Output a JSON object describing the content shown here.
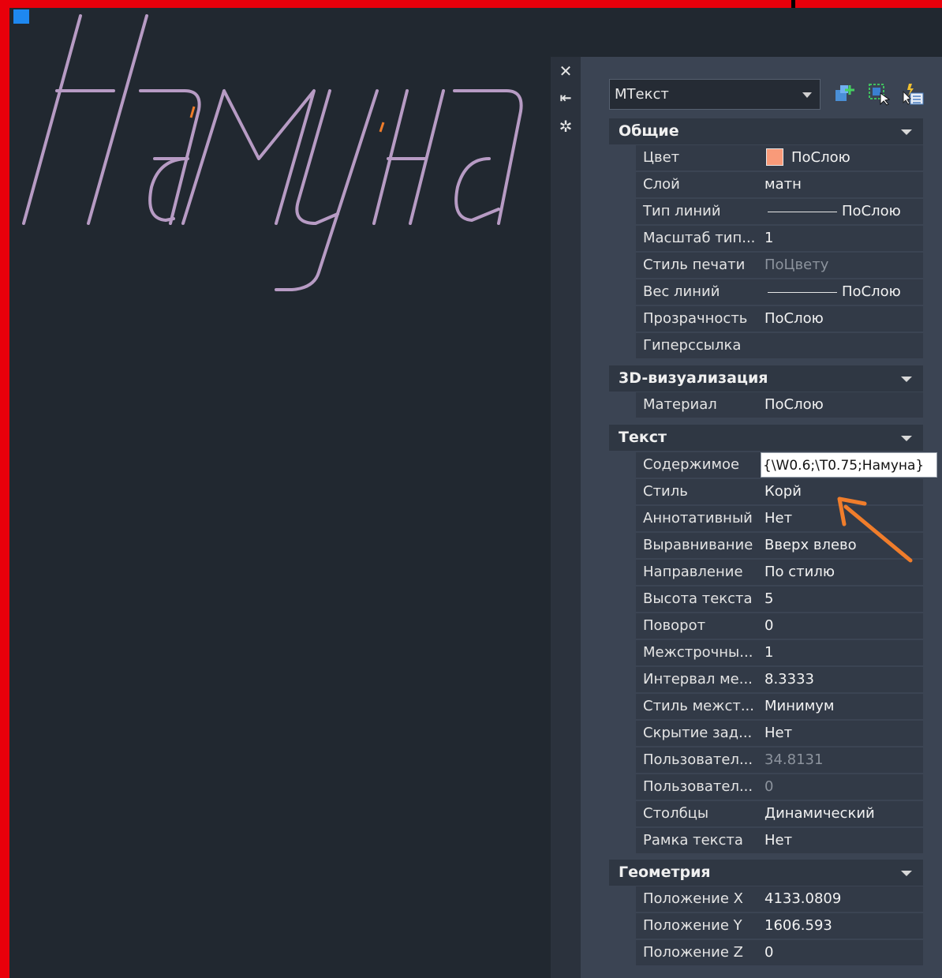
{
  "drawing": {
    "text": "Намуна"
  },
  "strip": {
    "close_glyph": "✕",
    "pin_glyph": "⇤",
    "settings_glyph": "✲"
  },
  "selector": {
    "value": "МТекст"
  },
  "sections": {
    "general": "Общие",
    "viz3d": "3D-визуализация",
    "text": "Текст",
    "geometry": "Геометрия"
  },
  "general": [
    {
      "key": "Цвет",
      "value": "ПоСлою",
      "swatch": "#f99a79"
    },
    {
      "key": "Слой",
      "value": "матн"
    },
    {
      "key": "Тип линий",
      "value": "ПоСлою"
    },
    {
      "key": "Масштаб тип...",
      "value": "1"
    },
    {
      "key": "Стиль печати",
      "value": "ПоЦвету"
    },
    {
      "key": "Вес линий",
      "value": "ПоСлою"
    },
    {
      "key": "Прозрачность",
      "value": "ПоСлою"
    },
    {
      "key": "Гиперссылка",
      "value": ""
    }
  ],
  "viz3d": [
    {
      "key": "Материал",
      "value": "ПоСлою"
    }
  ],
  "text": [
    {
      "key": "Содержимое",
      "value": "{\\W0.6;\\T0.75;Намуна}"
    },
    {
      "key": "Стиль",
      "value": "Корй"
    },
    {
      "key": "Аннотативный",
      "value": "Нет"
    },
    {
      "key": "Выравнивание",
      "value": "Вверх влево"
    },
    {
      "key": "Направление",
      "value": "По стилю"
    },
    {
      "key": "Высота текста",
      "value": "5"
    },
    {
      "key": "Поворот",
      "value": "0"
    },
    {
      "key": "Межстрочны...",
      "value": "1"
    },
    {
      "key": "Интервал ме...",
      "value": "8.3333"
    },
    {
      "key": "Стиль межст...",
      "value": "Минимум"
    },
    {
      "key": "Скрытие зад...",
      "value": "Нет"
    },
    {
      "key": "Пользовател...",
      "value": "34.8131"
    },
    {
      "key": "Пользовател...",
      "value": "0"
    },
    {
      "key": "Столбцы",
      "value": "Динамический"
    },
    {
      "key": "Рамка текста",
      "value": "Нет"
    }
  ],
  "geometry": [
    {
      "key": "Положение X",
      "value": "4133.0809"
    },
    {
      "key": "Положение Y",
      "value": "1606.593"
    },
    {
      "key": "Положение Z",
      "value": "0"
    }
  ],
  "colors": {
    "frame": "#e8000b",
    "canvas": "#212830",
    "text_stroke": "#b79bc4",
    "annotation_arrow": "#f07d2b",
    "grip": "#1e88f0"
  }
}
